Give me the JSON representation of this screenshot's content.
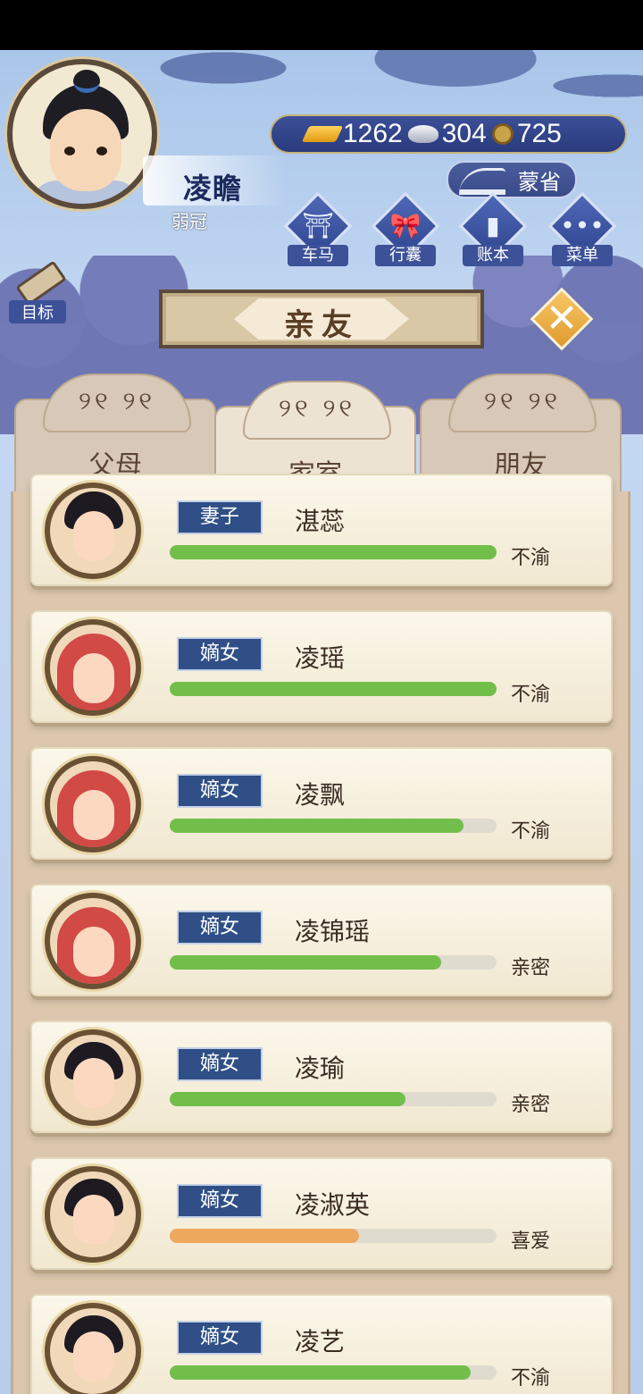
{
  "player": {
    "name": "凌瞻",
    "title": "弱冠"
  },
  "currency": {
    "gold": "1262",
    "silver": "304",
    "coins": "725"
  },
  "mengsheng_label": "蒙省",
  "shortcuts": [
    {
      "label": "车马",
      "icon": "carriage-icon"
    },
    {
      "label": "行囊",
      "icon": "bundle-icon"
    },
    {
      "label": "账本",
      "icon": "ledger-icon"
    },
    {
      "label": "菜单",
      "icon": "menu-dots-icon"
    }
  ],
  "goal_label": "目标",
  "page_title": "亲友",
  "tabs": [
    {
      "label": "父母",
      "active": false
    },
    {
      "label": "家室",
      "active": true
    },
    {
      "label": "朋友",
      "active": false
    }
  ],
  "members": [
    {
      "role": "妻子",
      "name": "湛蕊",
      "status": "不渝",
      "affinity": 1.0,
      "bar_color": "#72be4a",
      "portrait": "wife"
    },
    {
      "role": "嫡女",
      "name": "凌瑶",
      "status": "不渝",
      "affinity": 1.0,
      "bar_color": "#72be4a",
      "portrait": "baby"
    },
    {
      "role": "嫡女",
      "name": "凌飘",
      "status": "不渝",
      "affinity": 0.9,
      "bar_color": "#72be4a",
      "portrait": "baby"
    },
    {
      "role": "嫡女",
      "name": "凌锦瑶",
      "status": "亲密",
      "affinity": 0.83,
      "bar_color": "#72be4a",
      "portrait": "baby"
    },
    {
      "role": "嫡女",
      "name": "凌瑜",
      "status": "亲密",
      "affinity": 0.72,
      "bar_color": "#72be4a",
      "portrait": "girl"
    },
    {
      "role": "嫡女",
      "name": "凌淑英",
      "status": "喜爱",
      "affinity": 0.58,
      "bar_color": "#eea85e",
      "portrait": "girl"
    },
    {
      "role": "嫡女",
      "name": "凌艺",
      "status": "不渝",
      "affinity": 0.92,
      "bar_color": "#72be4a",
      "portrait": "girl2"
    }
  ]
}
